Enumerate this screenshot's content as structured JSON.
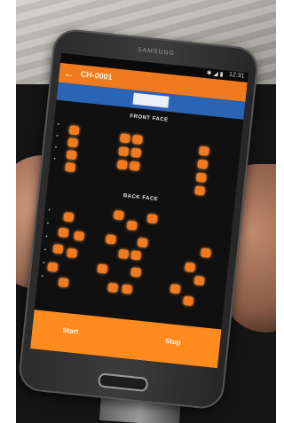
{
  "device": {
    "brand": "SAMSUNG"
  },
  "status_bar": {
    "time": "12:31",
    "icons": [
      "bluetooth-icon",
      "wifi-icon",
      "signal-icon",
      "battery-icon"
    ]
  },
  "app_bar": {
    "back_icon": "arrow-left-icon",
    "title": "CH-0001"
  },
  "tabs": {
    "items": [
      "",
      "",
      "",
      "",
      "",
      "",
      "",
      ""
    ]
  },
  "sections": {
    "top_label": "FRONT FACE",
    "bottom_label": "BACK FACE"
  },
  "bottom_bar": {
    "left_button": "Start",
    "right_button": "Stop"
  },
  "colors": {
    "led": "#f47a1f",
    "app_bar": "#f07b1f",
    "tab_bar": "#2b63b5",
    "bottom_bar": "#ff8a1e"
  }
}
